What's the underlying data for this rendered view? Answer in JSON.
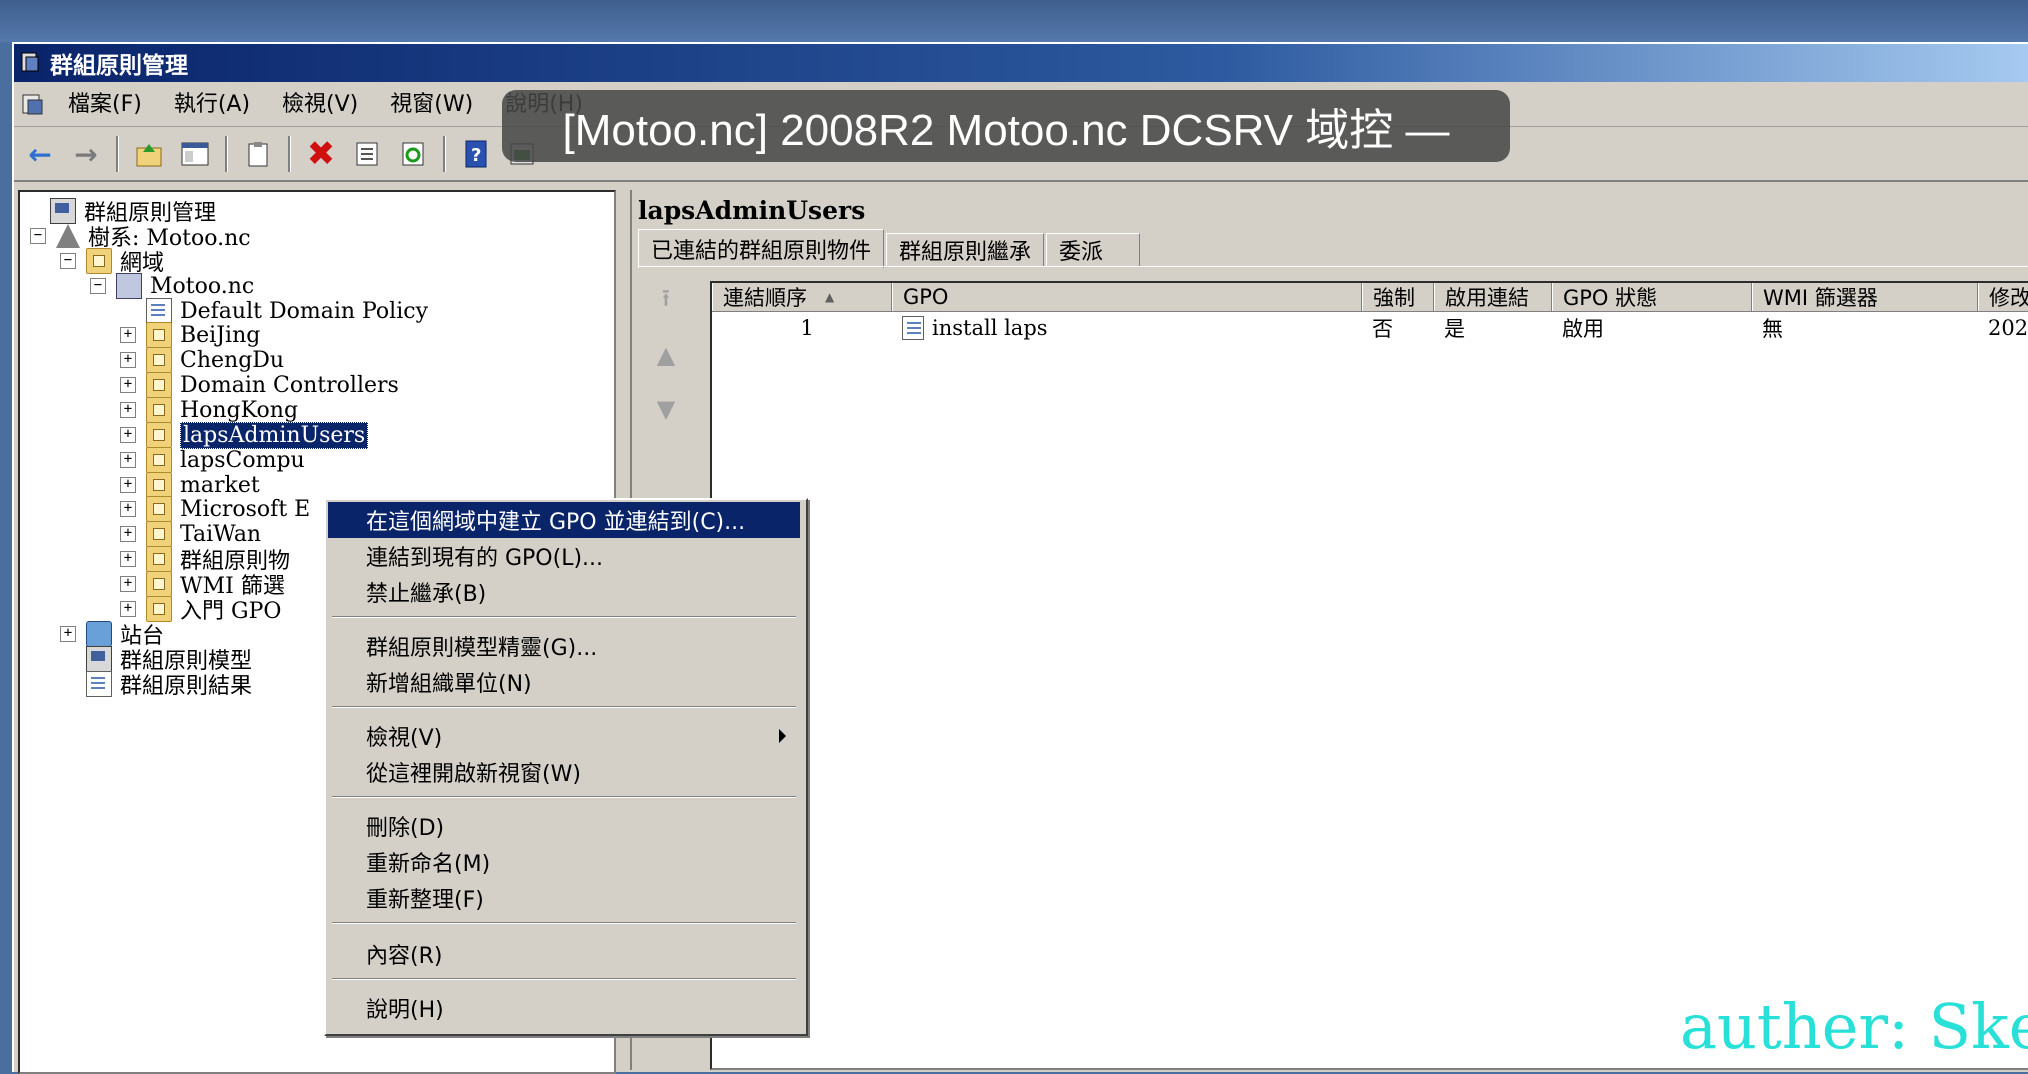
{
  "window": {
    "title": "群組原則管理"
  },
  "menubar": [
    "檔案(F)",
    "執行(A)",
    "檢視(V)",
    "視窗(W)",
    "說明(H)"
  ],
  "toolbar_icons": [
    "back-arrow-icon",
    "forward-arrow-icon",
    "up-folder-icon",
    "show-hide-tree-icon",
    "clipboard-icon",
    "delete-icon",
    "properties-icon",
    "refresh-icon",
    "help-icon",
    "console-icon"
  ],
  "overlay": {
    "text": "[Motoo.nc] 2008R2 Motoo.nc DCSRV 域控 —"
  },
  "tree": {
    "root": "群組原則管理",
    "forest": "樹系: Motoo.nc",
    "domains": "網域",
    "domain": "Motoo.nc",
    "items": [
      "Default Domain Policy",
      "BeiJing",
      "ChengDu",
      "Domain Controllers",
      "HongKong",
      "lapsAdminUsers",
      "lapsCompu",
      "market",
      "Microsoft E",
      "TaiWan",
      "群組原則物",
      "WMI 篩選",
      "入門 GPO"
    ],
    "sites": "站台",
    "modeling": "群組原則模型",
    "results": "群組原則結果"
  },
  "right_pane": {
    "title": "lapsAdminUsers",
    "tabs": [
      "已連結的群組原則物件",
      "群組原則繼承",
      "委派"
    ],
    "columns": [
      "連結順序",
      "GPO",
      "強制",
      "啟用連結",
      "GPO 狀態",
      "WMI 篩選器",
      "修改"
    ],
    "rows": [
      {
        "order": "1",
        "gpo": "install laps",
        "enforced": "否",
        "link_enabled": "是",
        "status": "啟用",
        "wmi": "無",
        "modified": "202"
      }
    ]
  },
  "context_menu": [
    "在這個網域中建立 GPO 並連結到(C)...",
    "連結到現有的 GPO(L)...",
    "禁止繼承(B)",
    "群組原則模型精靈(G)...",
    "新增組織單位(N)",
    "檢視(V)",
    "從這裡開啟新視窗(W)",
    "刪除(D)",
    "重新命名(M)",
    "重新整理(F)",
    "內容(R)",
    "說明(H)"
  ],
  "watermark": "auther: Ske",
  "colors": {
    "selection": "#0a246a",
    "watermark": "#28e0d8",
    "titlebar": "#0a246a"
  }
}
